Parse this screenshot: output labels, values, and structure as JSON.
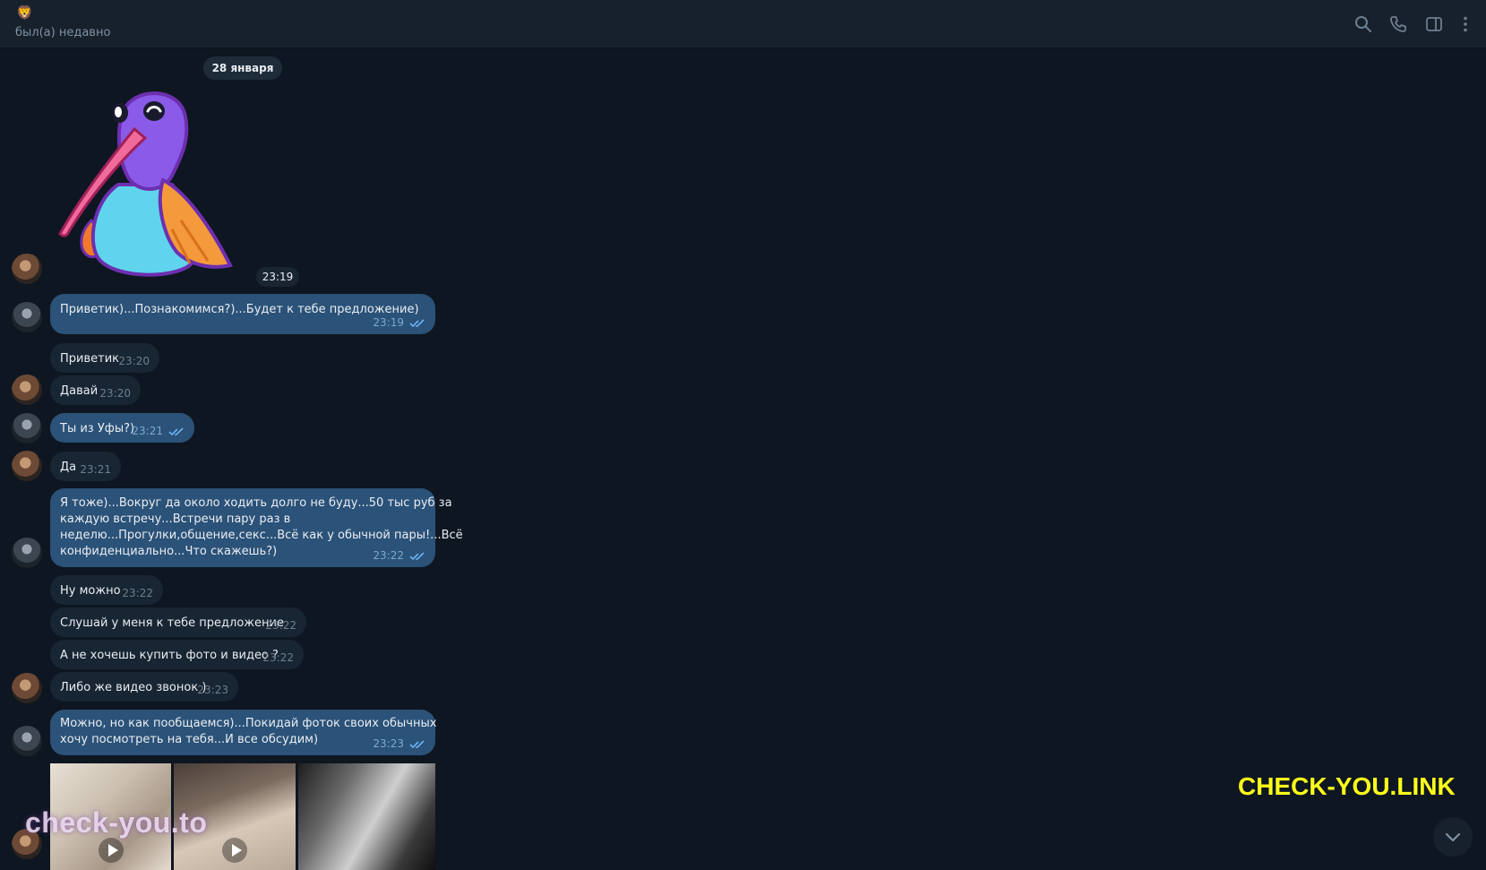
{
  "header": {
    "peer_emoji": "🦁",
    "status": "был(а) недавно",
    "icons": [
      "search-icon",
      "phone-icon",
      "sidebar-toggle-icon",
      "more-vertical-icon"
    ]
  },
  "date_separator": "28 января",
  "sticker": {
    "time": "23:19",
    "description_icon": "hummingbird-sticker"
  },
  "messages": [
    {
      "text": "Приветик)...Познакомимся?)...Будет к тебе предложение)",
      "time": "23:19",
      "direction": "out",
      "read": true
    },
    {
      "text": "Приветик",
      "time": "23:20",
      "direction": "in"
    },
    {
      "text": "Давай",
      "time": "23:20",
      "direction": "in"
    },
    {
      "text": "Ты из Уфы?)",
      "time": "23:21",
      "direction": "out",
      "read": true
    },
    {
      "text": "Да",
      "time": "23:21",
      "direction": "in"
    },
    {
      "lines": [
        "Я тоже)...Вокруг да около ходить долго не буду...50 тыс руб за",
        "каждую встречу...Встречи пару раз в",
        "неделю...Прогулки,общение,секс...Всё как у обычной пары!...Всё",
        "конфиденциально...Что скажешь?)"
      ],
      "time": "23:22",
      "direction": "out",
      "read": true
    },
    {
      "text": "Ну можно",
      "time": "23:22",
      "direction": "in"
    },
    {
      "text": "Слушай у меня к тебе предложение",
      "time": "23:22",
      "direction": "in"
    },
    {
      "text": "А не хочешь купить фото и видео ?",
      "time": "23:22",
      "direction": "in"
    },
    {
      "text": "Либо же видео звонок )",
      "time": "23:23",
      "direction": "in"
    },
    {
      "lines": [
        "Можно, но как пообщаемся)...Покидай фоток своих обычных",
        "хочу посмотреть на тебя...И все обсудим)"
      ],
      "time": "23:23",
      "direction": "out",
      "read": true
    }
  ],
  "watermarks": {
    "bottom_left": "check-you.to",
    "right": "CHECK-YOU.LINK"
  },
  "colors": {
    "background": "#0e1621",
    "header": "#17212b",
    "outgoing_bubble": "#2b5278",
    "incoming_bubble": "#182533",
    "tick_blue": "#6ab3f3",
    "watermark_yellow": "#ffff1a"
  }
}
